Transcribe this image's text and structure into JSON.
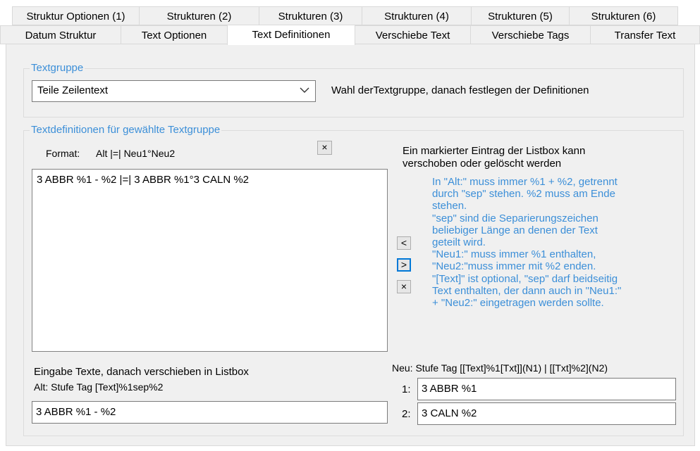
{
  "tabs_row1": [
    "Struktur Optionen (1)",
    "Strukturen (2)",
    "Strukturen (3)",
    "Strukturen (4)",
    "Strukturen (5)",
    "Strukturen (6)"
  ],
  "tabs_row2": [
    "Datum Struktur",
    "Text Optionen",
    "Text Definitionen",
    "Verschiebe Text",
    "Verschiebe Tags",
    "Transfer Text"
  ],
  "active_tab": "Text Definitionen",
  "textgruppe": {
    "legend": "Textgruppe",
    "selected": "Teile Zeilentext",
    "hint": "Wahl derTextgruppe, danach festlegen der Definitionen"
  },
  "textdef": {
    "legend": "Textdefinitionen für gewählte Textgruppe",
    "format_label": "Format:",
    "format_value": "Alt |=| Neu1°Neu2",
    "clear_symbol": "×",
    "list_items": [
      "3 ABBR %1 - %2 |=| 3 ABBR %1°3 CALN %2"
    ],
    "info_line1": "Ein markierter Eintrag der Listbox kann",
    "info_line2": "verschoben oder gelöscht werden",
    "help_lines": [
      "In \"Alt:\" muss immer %1 + %2, getrennt",
      "durch \"sep\" stehen. %2 muss am Ende",
      "stehen.",
      "\"sep\" sind die Separierungszeichen",
      "beliebiger Länge an denen der Text",
      "geteilt wird.",
      "\"Neu1:\" muss immer %1 enthalten,",
      "\"Neu2:\"muss immer mit %2 enden.",
      "\"[Text]\" ist optional, \"sep\" darf beidseitig",
      "Text enthalten, der dann auch in \"Neu1:\"",
      "+ \"Neu2:\" eingetragen werden sollte."
    ],
    "btn_left": "<",
    "btn_right": ">",
    "btn_delete": "×",
    "eingabe_label": "Eingabe Texte, danach verschieben in Listbox",
    "alt_label": "Alt: Stufe Tag [Text]%1sep%2",
    "alt_value": "3 ABBR %1 - %2",
    "neu_label": "Neu: Stufe Tag [[Text]%1[Txt]](N1) | [[Txt]%2](N2)",
    "neu1_label": "1:",
    "neu1_value": "3 ABBR %1",
    "neu2_label": "2:",
    "neu2_value": "3 CALN %2"
  }
}
